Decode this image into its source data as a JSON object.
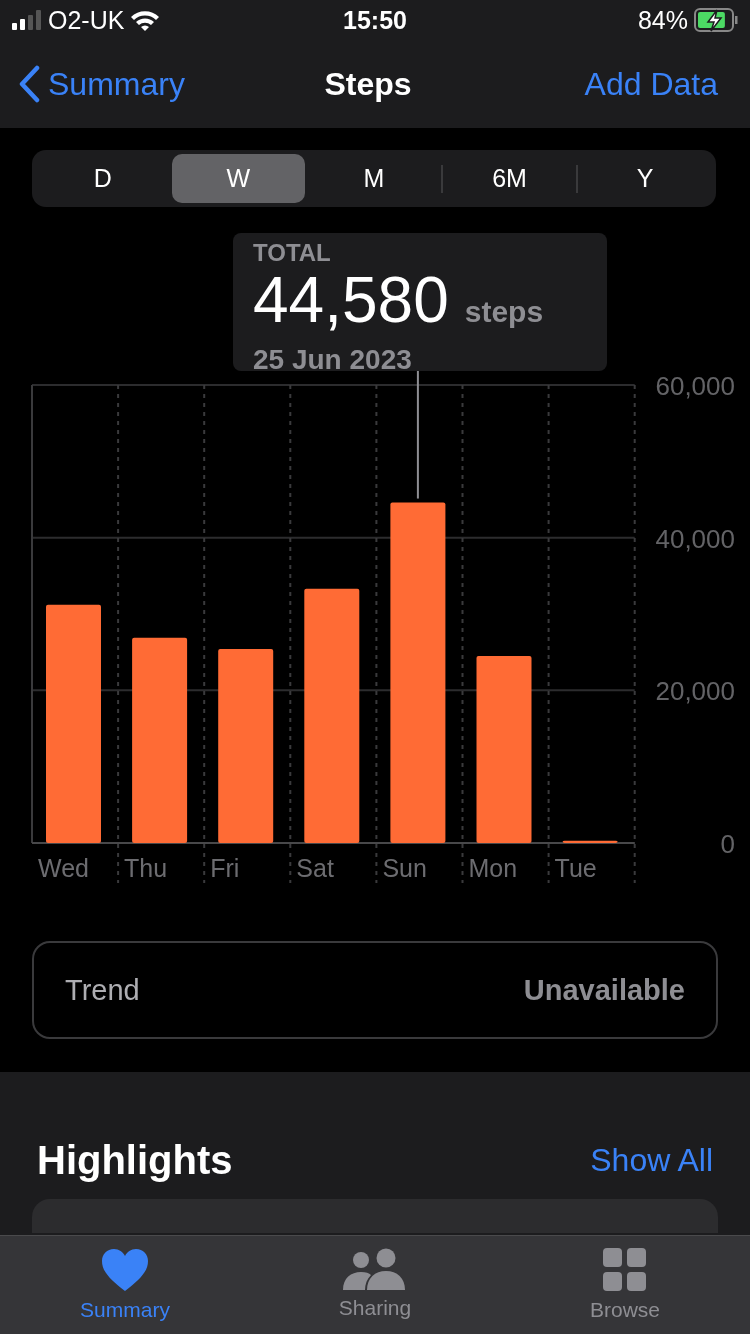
{
  "status_bar": {
    "carrier": "O2-UK",
    "time": "15:50",
    "battery": "84%",
    "charging": true
  },
  "nav": {
    "back": "Summary",
    "title": "Steps",
    "action": "Add Data"
  },
  "range_tabs": [
    {
      "label": "D",
      "selected": false
    },
    {
      "label": "W",
      "selected": true
    },
    {
      "label": "M",
      "selected": false
    },
    {
      "label": "6M",
      "selected": false
    },
    {
      "label": "Y",
      "selected": false
    }
  ],
  "tooltip": {
    "label": "TOTAL",
    "value": "44,580",
    "unit": "steps",
    "date": "25 Jun 2023"
  },
  "chart": {
    "chart_data": {
      "type": "bar",
      "categories": [
        "Wed",
        "Thu",
        "Fri",
        "Sat",
        "Sun",
        "Mon",
        "Tue"
      ],
      "values": [
        31200,
        26900,
        25400,
        33300,
        44600,
        24500,
        300
      ],
      "ylim": [
        0,
        60000
      ],
      "yticks": [
        {
          "value": 0,
          "label": "0"
        },
        {
          "value": 20000,
          "label": "20,000"
        },
        {
          "value": 40000,
          "label": "40,000"
        },
        {
          "value": 60000,
          "label": "60,000"
        }
      ]
    }
  },
  "trend": {
    "label": "Trend",
    "value": "Unavailable"
  },
  "highlights": {
    "title": "Highlights",
    "link": "Show All"
  },
  "tab_bar": [
    {
      "label": "Summary",
      "selected": true
    },
    {
      "label": "Sharing",
      "selected": false
    },
    {
      "label": "Browse",
      "selected": false
    }
  ]
}
